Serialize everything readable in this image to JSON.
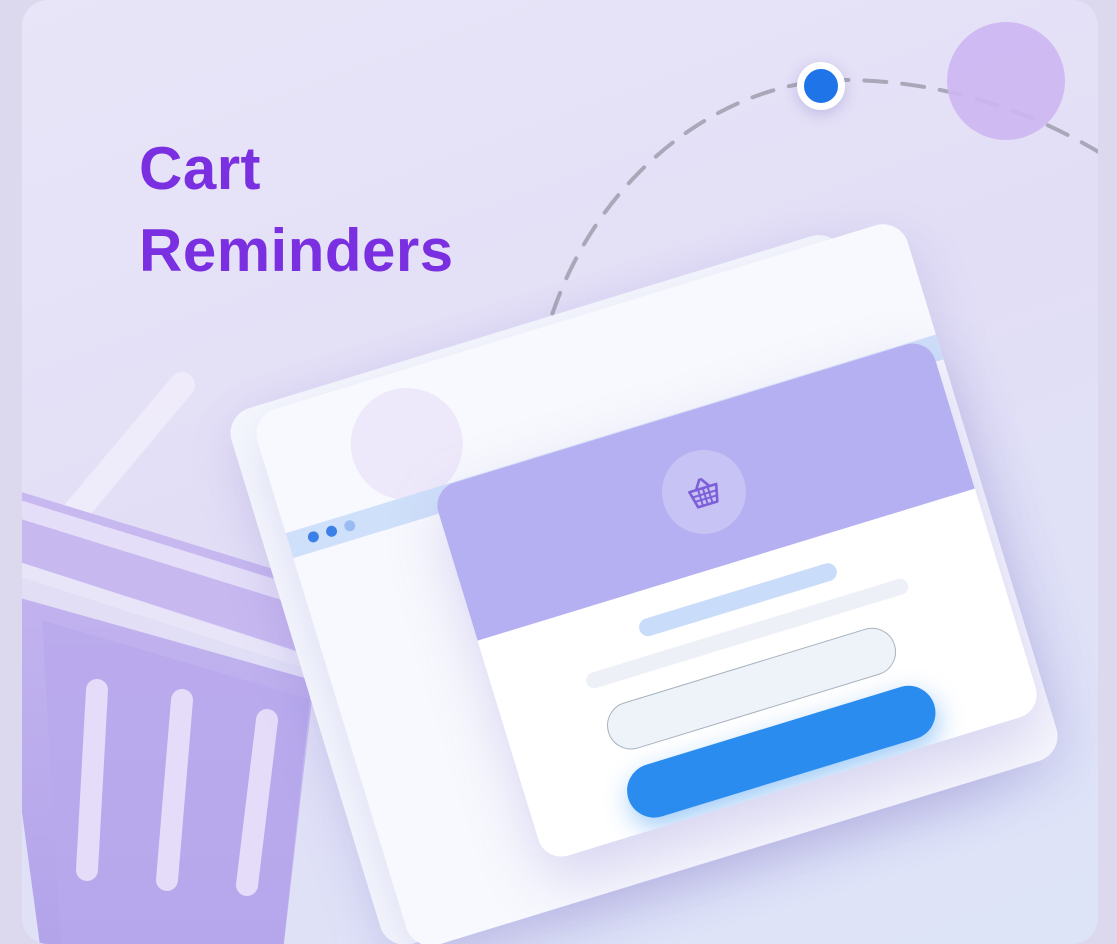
{
  "card": {
    "title_line1": "Cart",
    "title_line2": "Reminders"
  },
  "colors": {
    "title": "#7a2fe0",
    "accent_dot": "#1f74e8",
    "popup_header": "#b5b0f1",
    "button": "#2b8cf0",
    "background": "#e6e2f7"
  },
  "icons": {
    "popup_icon": "shopping-basket-icon",
    "background_art": "shopping-basket-illustration"
  }
}
